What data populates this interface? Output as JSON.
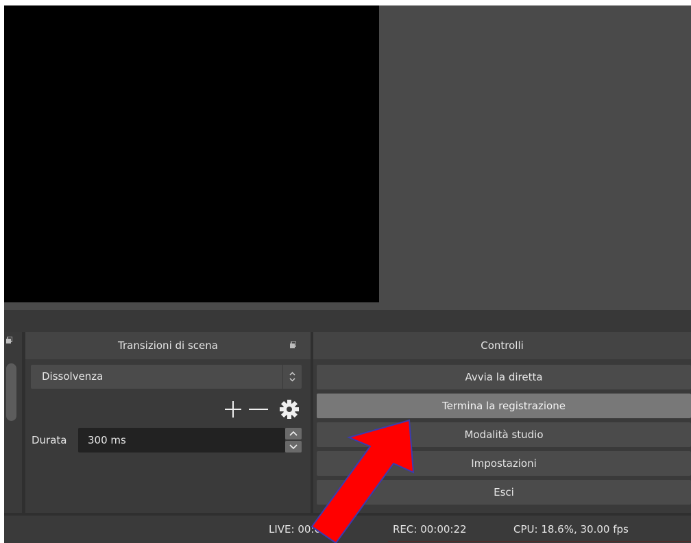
{
  "docks": {
    "transitions": {
      "title": "Transizioni di scena",
      "selected_transition": "Dissolvenza",
      "duration_label": "Durata",
      "duration_value": "300 ms",
      "icons": [
        "plus-icon",
        "minus-icon",
        "gear-icon"
      ]
    },
    "controls": {
      "title": "Controlli",
      "buttons": [
        {
          "label": "Avvia la diretta"
        },
        {
          "label": "Termina la registrazione",
          "highlighted": true
        },
        {
          "label": "Modalità studio"
        },
        {
          "label": "Impostazioni"
        },
        {
          "label": "Esci"
        }
      ]
    }
  },
  "status_bar": {
    "live": "LIVE: 00:00:00",
    "rec": "REC: 00:00:22",
    "cpu": "CPU: 18.6%, 30.00 fps"
  },
  "colors": {
    "background": "#2f2f2f",
    "panel": "#3a3a3a",
    "button": "#4b4b4b",
    "button_highlight": "#787878",
    "preview": "#000000",
    "annotation_arrow": "#ff0000",
    "annotation_arrow_outline": "#3b3bb0"
  }
}
